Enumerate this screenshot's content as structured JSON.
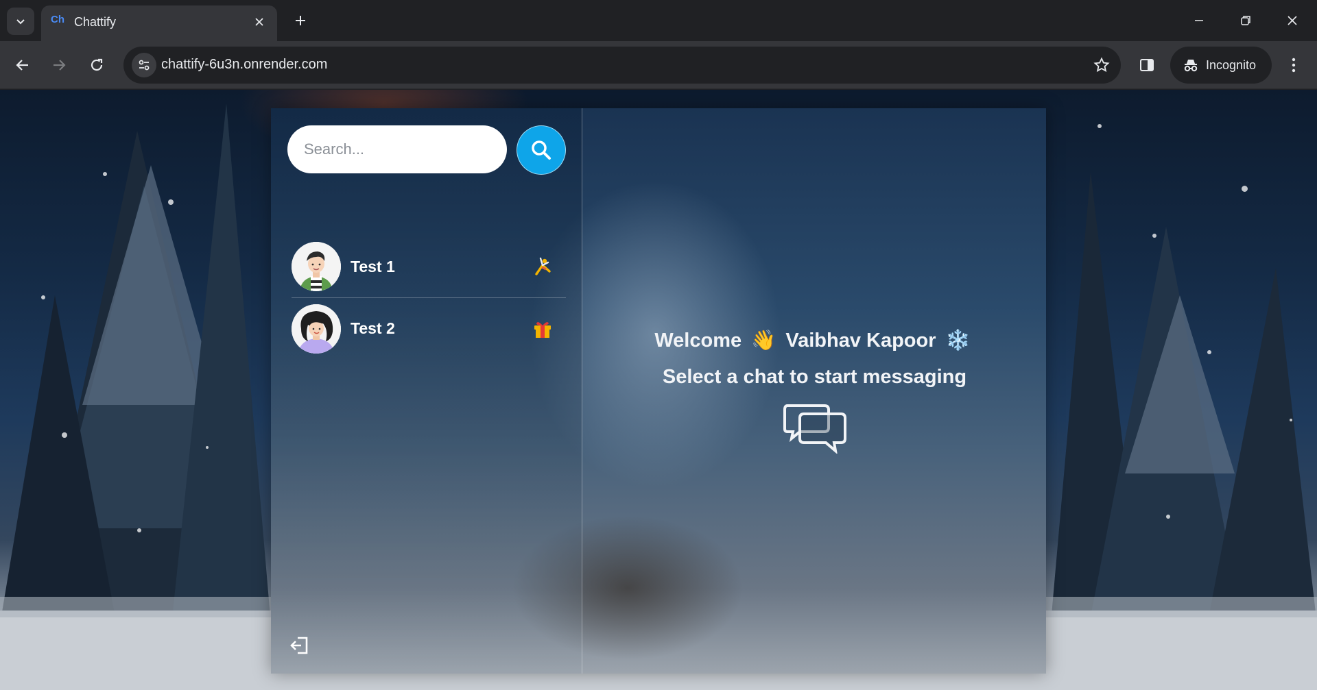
{
  "browser": {
    "tab": {
      "favicon": "Ch",
      "title": "Chattify"
    },
    "url": "chattify-6u3n.onrender.com",
    "profile_label": "Incognito",
    "icons": [
      "tab-search-icon",
      "close-icon",
      "plus-icon",
      "minimize-icon",
      "restore-icon",
      "window-close-icon",
      "back-icon",
      "forward-icon",
      "reload-icon",
      "site-info-icon",
      "star-icon",
      "side-panel-icon",
      "incognito-icon",
      "more-icon"
    ]
  },
  "sidebar": {
    "search_placeholder": "Search...",
    "chats": [
      {
        "name": "Test 1",
        "avatar": "male-avatar",
        "emoji": "🤸"
      },
      {
        "name": "Test 2",
        "avatar": "female-avatar",
        "emoji": "🎁"
      }
    ]
  },
  "main": {
    "welcome_prefix": "Welcome",
    "wave_emoji": "👋",
    "user_name": "Vaibhav Kapoor",
    "snow_emoji": "❄️",
    "subtitle": "Select a chat to start messaging"
  },
  "colors": {
    "accent": "#0ea5e9",
    "chrome_bg": "#202124",
    "toolbar_bg": "#35363a",
    "text_light": "#f2f4f7"
  }
}
